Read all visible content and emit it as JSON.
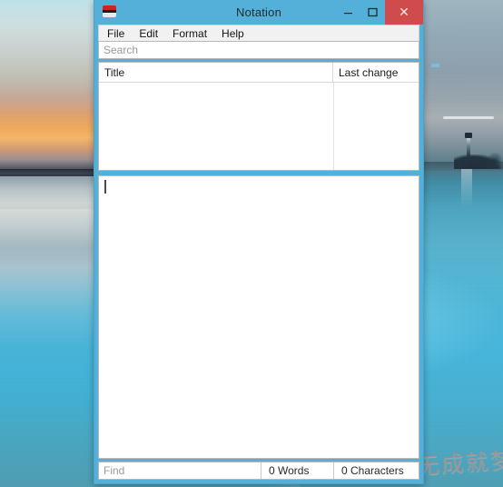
{
  "desktop": {
    "wallpaper_description": "sunset seascape with lighthouse",
    "watermark_text": "学无成就梦想"
  },
  "window": {
    "title": "Notation",
    "icon": "notebook-icon",
    "frame_color": "#54b0d8",
    "controls": {
      "minimize": "minimize-button",
      "maximize": "maximize-button",
      "close": "close-button",
      "close_color": "#d04b4b"
    }
  },
  "menu": {
    "items": [
      {
        "label": "File"
      },
      {
        "label": "Edit"
      },
      {
        "label": "Format"
      },
      {
        "label": "Help"
      }
    ]
  },
  "search": {
    "value": "",
    "placeholder": "Search"
  },
  "note_list": {
    "columns": [
      {
        "key": "title",
        "label": "Title"
      },
      {
        "key": "last_change",
        "label": "Last change"
      }
    ],
    "rows": [],
    "empty": true
  },
  "editor": {
    "value": "",
    "placeholder": "",
    "caret_visible": true
  },
  "status_bar": {
    "find": {
      "value": "",
      "placeholder": "Find"
    },
    "word_count": "0 Words",
    "character_count": "0 Characters"
  }
}
